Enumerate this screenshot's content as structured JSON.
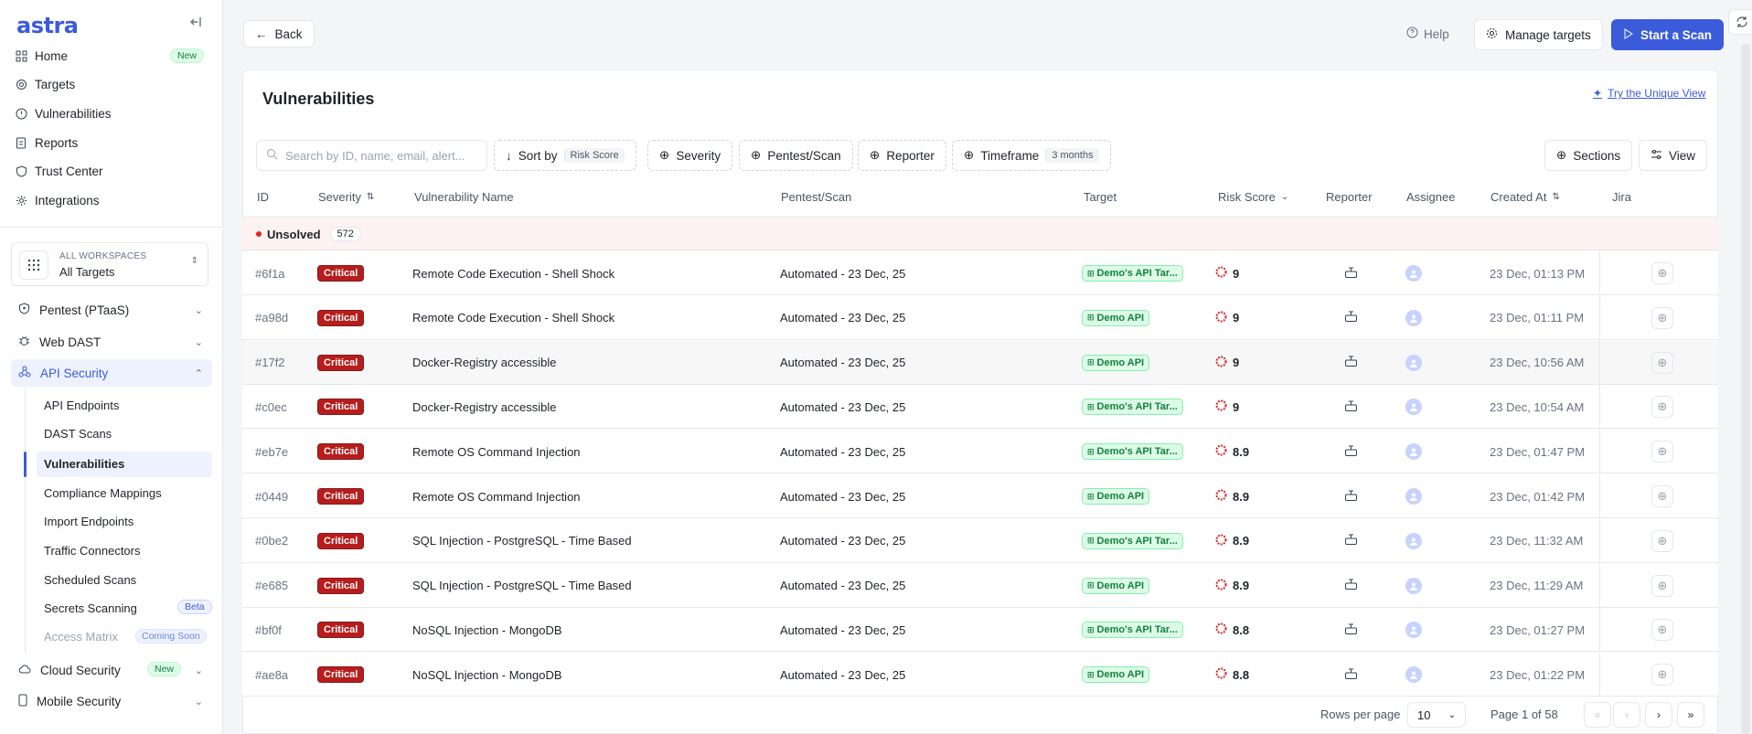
{
  "brand": "astra",
  "nav": {
    "home": "Home",
    "home_badge": "New",
    "targets": "Targets",
    "vulnerabilities": "Vulnerabilities",
    "reports": "Reports",
    "trust_center": "Trust Center",
    "integrations": "Integrations"
  },
  "workspace": {
    "label": "ALL WORKSPACES",
    "value": "All Targets"
  },
  "groups": {
    "pentest": "Pentest (PTaaS)",
    "web_dast": "Web DAST",
    "api_security": "API Security",
    "cloud_security": "Cloud Security",
    "cloud_badge": "New",
    "mobile_security": "Mobile Security"
  },
  "subnav": {
    "api_endpoints": "API Endpoints",
    "dast_scans": "DAST Scans",
    "vulnerabilities": "Vulnerabilities",
    "compliance": "Compliance Mappings",
    "import_endpoints": "Import Endpoints",
    "traffic_connectors": "Traffic Connectors",
    "scheduled_scans": "Scheduled Scans",
    "secrets_scanning": "Secrets Scanning",
    "secrets_badge": "Beta",
    "access_matrix": "Access Matrix",
    "access_badge": "Coming Soon"
  },
  "topbar": {
    "back": "Back",
    "help": "Help",
    "manage_targets": "Manage targets",
    "start_scan": "Start a Scan"
  },
  "page": {
    "title": "Vulnerabilities",
    "unique_view": "Try the Unique View"
  },
  "toolbar": {
    "search_placeholder": "Search by ID, name, email, alert...",
    "sort_by": "Sort by",
    "sort_value": "Risk Score",
    "severity": "Severity",
    "pentest_scan": "Pentest/Scan",
    "reporter": "Reporter",
    "timeframe": "Timeframe",
    "timeframe_value": "3 months",
    "sections": "Sections",
    "view": "View"
  },
  "columns": {
    "id": "ID",
    "severity": "Severity",
    "name": "Vulnerability Name",
    "pentest": "Pentest/Scan",
    "target": "Target",
    "risk": "Risk Score",
    "reporter": "Reporter",
    "assignee": "Assignee",
    "created": "Created At",
    "jira": "Jira"
  },
  "group": {
    "label": "Unsolved",
    "count": "572"
  },
  "rows": [
    {
      "id": "#6f1a",
      "severity": "Critical",
      "name": "Remote Code Execution - Shell Shock",
      "pentest": "Automated - 23 Dec, 25",
      "target": "Demo's API Tar...",
      "risk": "9",
      "created": "23 Dec, 01:13 PM"
    },
    {
      "id": "#a98d",
      "severity": "Critical",
      "name": "Remote Code Execution - Shell Shock",
      "pentest": "Automated - 23 Dec, 25",
      "target": "Demo API",
      "risk": "9",
      "created": "23 Dec, 01:11 PM"
    },
    {
      "id": "#17f2",
      "severity": "Critical",
      "name": "Docker-Registry accessible",
      "pentest": "Automated - 23 Dec, 25",
      "target": "Demo API",
      "risk": "9",
      "created": "23 Dec, 10:56 AM"
    },
    {
      "id": "#c0ec",
      "severity": "Critical",
      "name": "Docker-Registry accessible",
      "pentest": "Automated - 23 Dec, 25",
      "target": "Demo's API Tar...",
      "risk": "9",
      "created": "23 Dec, 10:54 AM"
    },
    {
      "id": "#eb7e",
      "severity": "Critical",
      "name": "Remote OS Command Injection",
      "pentest": "Automated - 23 Dec, 25",
      "target": "Demo's API Tar...",
      "risk": "8.9",
      "created": "23 Dec, 01:47 PM"
    },
    {
      "id": "#0449",
      "severity": "Critical",
      "name": "Remote OS Command Injection",
      "pentest": "Automated - 23 Dec, 25",
      "target": "Demo API",
      "risk": "8.9",
      "created": "23 Dec, 01:42 PM"
    },
    {
      "id": "#0be2",
      "severity": "Critical",
      "name": "SQL Injection - PostgreSQL - Time Based",
      "pentest": "Automated - 23 Dec, 25",
      "target": "Demo's API Tar...",
      "risk": "8.9",
      "created": "23 Dec, 11:32 AM"
    },
    {
      "id": "#e685",
      "severity": "Critical",
      "name": "SQL Injection - PostgreSQL - Time Based",
      "pentest": "Automated - 23 Dec, 25",
      "target": "Demo API",
      "risk": "8.9",
      "created": "23 Dec, 11:29 AM"
    },
    {
      "id": "#bf0f",
      "severity": "Critical",
      "name": "NoSQL Injection - MongoDB",
      "pentest": "Automated - 23 Dec, 25",
      "target": "Demo's API Tar...",
      "risk": "8.8",
      "created": "23 Dec, 01:27 PM"
    },
    {
      "id": "#ae8a",
      "severity": "Critical",
      "name": "NoSQL Injection - MongoDB",
      "pentest": "Automated - 23 Dec, 25",
      "target": "Demo API",
      "risk": "8.8",
      "created": "23 Dec, 01:22 PM"
    }
  ],
  "pagination": {
    "rows_per_page_label": "Rows per page",
    "rows_per_page": "10",
    "page_info": "Page 1 of 58"
  },
  "colors": {
    "accent": "#3b5bdb",
    "critical": "#b91c1c",
    "target": "#15803d"
  }
}
